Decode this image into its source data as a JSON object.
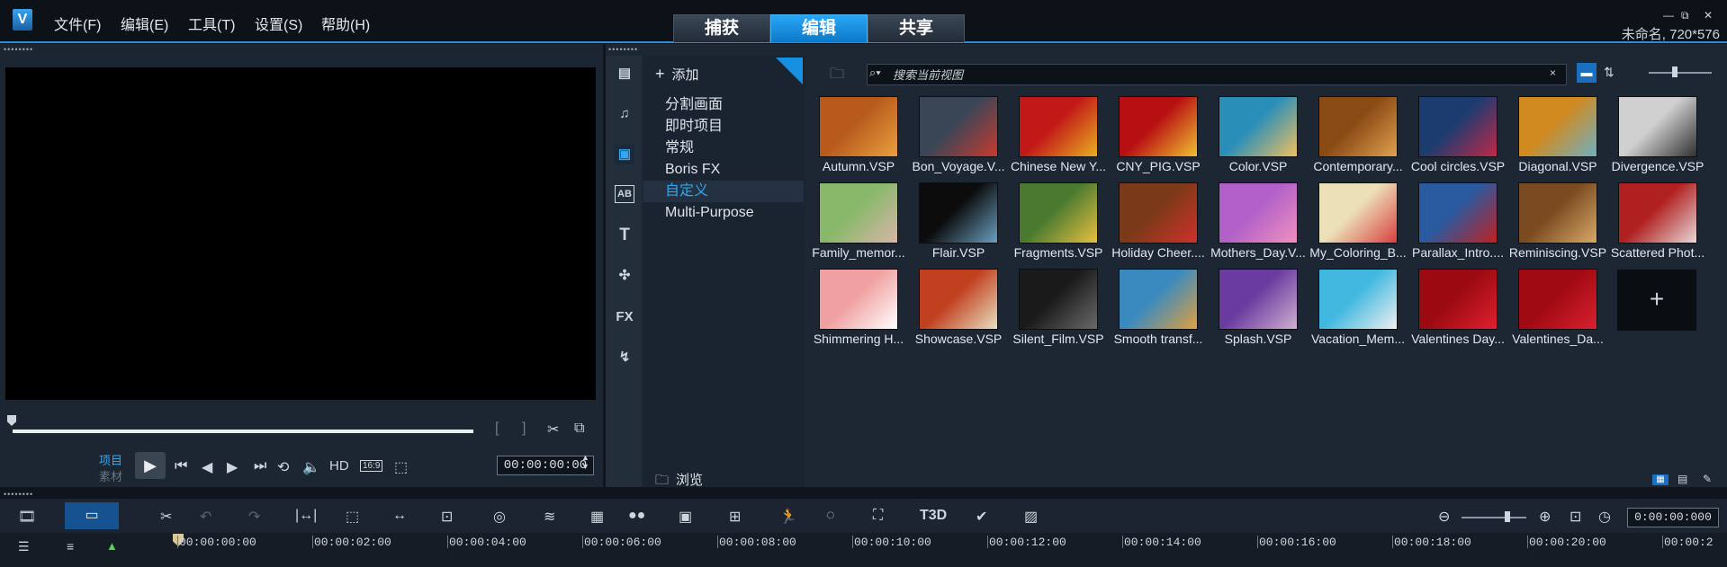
{
  "app": {
    "logo_text": "V",
    "window_buttons": [
      "—",
      "⧉",
      "✕"
    ],
    "project_info": "未命名, 720*576"
  },
  "menu": [
    "文件(F)",
    "编辑(E)",
    "工具(T)",
    "设置(S)",
    "帮助(H)"
  ],
  "main_tabs": [
    {
      "label": "捕获"
    },
    {
      "label": "编辑",
      "active": true
    },
    {
      "label": "共享"
    }
  ],
  "player": {
    "mode_project": "项目",
    "mode_clip": "素材",
    "timecode": "00:00:00:00",
    "hd_label": "HD",
    "ratio_label": "16:9"
  },
  "library": {
    "add_label": "添加",
    "categories": [
      {
        "label": "分割画面"
      },
      {
        "label": "即时项目"
      },
      {
        "label": "常规"
      },
      {
        "label": "Boris FX"
      },
      {
        "label": "自定义",
        "selected": true
      },
      {
        "label": "Multi-Purpose"
      }
    ],
    "browse_label": "浏览",
    "search_placeholder": "搜索当前视图",
    "items": [
      {
        "label": "Autumn.VSP",
        "c1": "#b85a1c",
        "c2": "#e8a040"
      },
      {
        "label": "Bon_Voyage.V...",
        "c1": "#3a4656",
        "c2": "#c83a30"
      },
      {
        "label": "Chinese New Y...",
        "c1": "#c21818",
        "c2": "#e8b020"
      },
      {
        "label": "CNY_PIG.VSP",
        "c1": "#b80f12",
        "c2": "#f0c030"
      },
      {
        "label": "Color.VSP",
        "c1": "#2a8fb8",
        "c2": "#f0c060"
      },
      {
        "label": "Contemporary...",
        "c1": "#8a4a14",
        "c2": "#e0a050"
      },
      {
        "label": "Cool circles.VSP",
        "c1": "#1c3c70",
        "c2": "#c02848"
      },
      {
        "label": "Diagonal.VSP",
        "c1": "#d08a20",
        "c2": "#6fb0c0"
      },
      {
        "label": "Divergence.VSP",
        "c1": "#d0d0d0",
        "c2": "#303030"
      },
      {
        "label": "Family_memor...",
        "c1": "#88b86a",
        "c2": "#d8b6a8"
      },
      {
        "label": "Flair.VSP",
        "c1": "#0c0c0c",
        "c2": "#6aa0c0"
      },
      {
        "label": "Fragments.VSP",
        "c1": "#4a7a30",
        "c2": "#e8c040"
      },
      {
        "label": "Holiday Cheer....",
        "c1": "#7a3a18",
        "c2": "#d0302a"
      },
      {
        "label": "Mothers_Day.V...",
        "c1": "#b060c8",
        "c2": "#f090c0"
      },
      {
        "label": "My_Coloring_B...",
        "c1": "#ece0b8",
        "c2": "#d84040"
      },
      {
        "label": "Parallax_Intro....",
        "c1": "#2a5aa0",
        "c2": "#c02020"
      },
      {
        "label": "Reminiscing.VSP",
        "c1": "#7a4a20",
        "c2": "#d8a868"
      },
      {
        "label": "Scattered Phot...",
        "c1": "#b02020",
        "c2": "#e8d8d8"
      },
      {
        "label": "Shimmering H...",
        "c1": "#f0a0a0",
        "c2": "#ffffff"
      },
      {
        "label": "Showcase.VSP",
        "c1": "#c04020",
        "c2": "#e8e0c0"
      },
      {
        "label": "Silent_Film.VSP",
        "c1": "#1a1a1a",
        "c2": "#6a6a6a"
      },
      {
        "label": "Smooth transf...",
        "c1": "#3a8ac0",
        "c2": "#e0a040"
      },
      {
        "label": "Splash.VSP",
        "c1": "#6a3ca0",
        "c2": "#d0b0d0"
      },
      {
        "label": "Vacation_Mem...",
        "c1": "#40b8e0",
        "c2": "#f0f0f0"
      },
      {
        "label": "Valentines Day...",
        "c1": "#9a0a10",
        "c2": "#e02030"
      },
      {
        "label": "Valentines_Da...",
        "c1": "#a00a12",
        "c2": "#d82030"
      }
    ],
    "add_template_label": "+"
  },
  "timeline": {
    "timecode": "0:00:00:000",
    "ruler": [
      "00:00:00:00",
      "00:00:02:00",
      "00:00:04:00",
      "00:00:06:00",
      "00:00:08:00",
      "00:00:10:00",
      "00:00:12:00",
      "00:00:14:00",
      "00:00:16:00",
      "00:00:18:00",
      "00:00:20:00",
      "00:00:2"
    ],
    "three_d_label": "T3D",
    "fx_label": "FX"
  },
  "colors": {
    "accent": "#2a8fd8",
    "selected_text": "#31a7ef"
  }
}
